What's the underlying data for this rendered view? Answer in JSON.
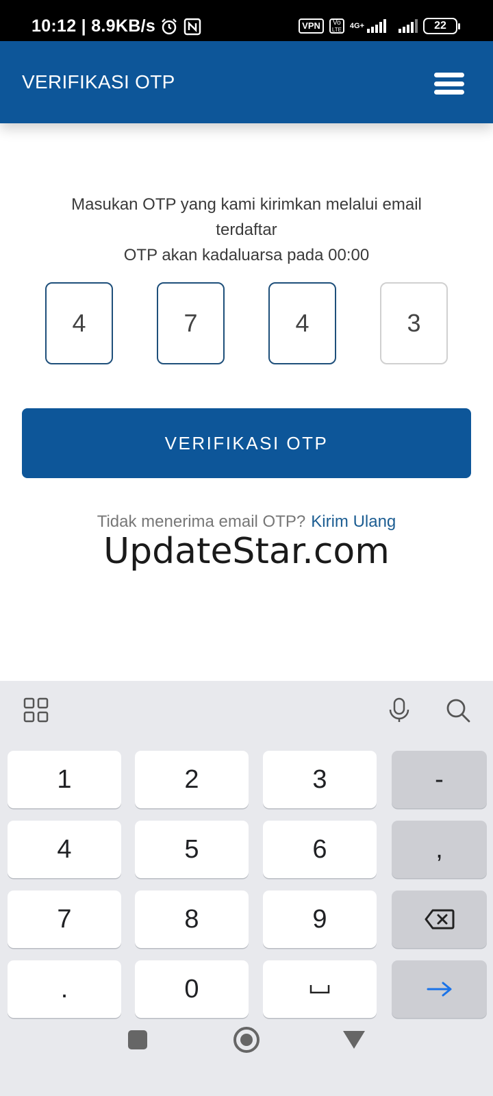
{
  "status_bar": {
    "time_speed": "10:12 | 8.9KB/s",
    "vpn": "VPN",
    "volte_top": "Vo",
    "volte_bottom": "LTE",
    "network": "4G+",
    "battery": "22"
  },
  "app_bar": {
    "title": "VERIFIKASI OTP"
  },
  "otp": {
    "instruction_line1": "Masukan OTP yang kami kirimkan melalui email terdaftar",
    "instruction_line2": "OTP akan kadaluarsa pada 00:00",
    "digits": [
      "4",
      "7",
      "4",
      "3"
    ],
    "verify_label": "VERIFIKASI OTP",
    "resend_prompt": "Tidak menerima email OTP?",
    "resend_link": "Kirim Ulang"
  },
  "watermark": "UpdateStar.com",
  "keyboard": {
    "keys": [
      [
        "1",
        "2",
        "3",
        "-"
      ],
      [
        "4",
        "5",
        "6",
        ","
      ],
      [
        "7",
        "8",
        "9"
      ],
      [
        ".",
        "0"
      ]
    ],
    "colors": {
      "background": "#e8e9ed",
      "key": "#ffffff",
      "function_key": "#cdced3",
      "enter_arrow": "#1a73e8"
    }
  },
  "colors": {
    "primary": "#0d5699",
    "otp_border": "#1e4f7a",
    "link": "#1c5d92"
  }
}
